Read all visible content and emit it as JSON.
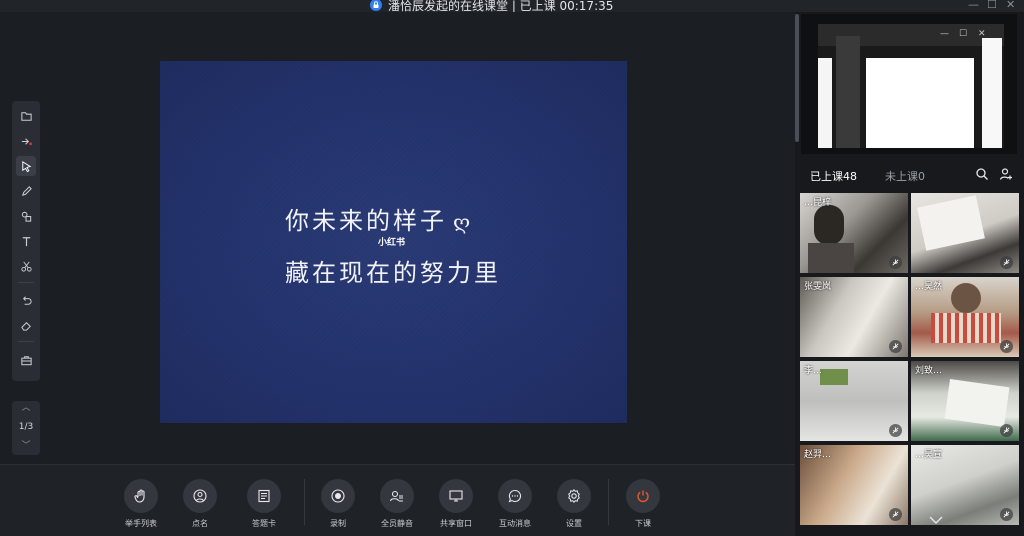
{
  "window": {
    "title": "潘恰辰发起的在线课堂 | 已上课 00:17:35",
    "minimize_glyph": "—",
    "maximize_glyph": "☐",
    "close_glyph": "✕"
  },
  "slide": {
    "line1": "你未来的样子",
    "line2": "藏在现在的努力里",
    "brand": "小红书"
  },
  "pager": {
    "page": "1/3",
    "up_glyph": "︿",
    "down_glyph": "﹀"
  },
  "controls": [
    {
      "id": "hand-list",
      "label": "举手列表"
    },
    {
      "id": "roll-call",
      "label": "点名"
    },
    {
      "id": "answer-card",
      "label": "答题卡"
    },
    {
      "id": "record",
      "label": "录制"
    },
    {
      "id": "mute-all",
      "label": "全员静音"
    },
    {
      "id": "share-window",
      "label": "共享窗口"
    },
    {
      "id": "interactive-msg",
      "label": "互动消息"
    },
    {
      "id": "settings",
      "label": "设置"
    },
    {
      "id": "end-class",
      "label": "下课"
    }
  ],
  "teacher_window": {
    "minimize_glyph": "—",
    "maximize_glyph": "☐",
    "close_glyph": "✕"
  },
  "tabs": {
    "in_class": "已上课48",
    "not_in_class": "未上课0"
  },
  "students": [
    {
      "name": "…昆梓"
    },
    {
      "name": ""
    },
    {
      "name": "张雯岚"
    },
    {
      "name": "…昊然"
    },
    {
      "name": "李…"
    },
    {
      "name": "刘致…"
    },
    {
      "name": "赵羿…"
    },
    {
      "name": "…昊宣"
    }
  ],
  "colors": {
    "accent": "#e0582c",
    "slide_bg": "#24346c"
  }
}
